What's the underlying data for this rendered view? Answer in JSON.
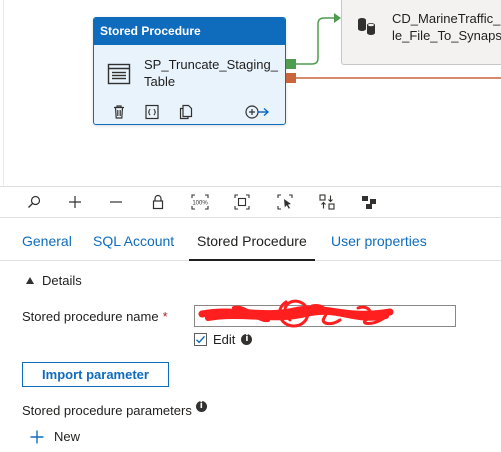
{
  "activity": {
    "header": "Stored Procedure",
    "name": "SP_Truncate_Staging_Table",
    "icon": "stored-procedure-icon",
    "actions": [
      "delete-icon",
      "code-icon",
      "copy-icon",
      "add-output-icon"
    ]
  },
  "next_activity": {
    "name": "CD_MarineTraffic_\nle_File_To_Synapse",
    "icon": "database-icon"
  },
  "toolbar": {
    "buttons": [
      "search-icon",
      "zoom-in-icon",
      "zoom-out-icon",
      "lock-icon",
      "zoom-100-icon",
      "fit-to-screen-icon",
      "select-icon",
      "auto-align-icon",
      "layout-icon"
    ],
    "zoom_label": "100%"
  },
  "tabs": [
    {
      "label": "General",
      "active": false
    },
    {
      "label": "SQL Account",
      "active": false
    },
    {
      "label": "Stored Procedure",
      "active": true
    },
    {
      "label": "User properties",
      "active": false
    }
  ],
  "details": {
    "section_label": "Details",
    "sp_name_label": "Stored procedure name",
    "required_marker": "*",
    "sp_name_value": "",
    "edit_label": "Edit",
    "edit_checked": true,
    "import_button": "Import parameter",
    "params_label": "Stored procedure parameters",
    "new_label": "New"
  },
  "colors": {
    "accent": "#0f6cbd",
    "activity_bg": "#e8f3fc",
    "success_port": "#4e9c4e",
    "failure_port": "#c9643c",
    "redaction": "#ff1f1f"
  }
}
